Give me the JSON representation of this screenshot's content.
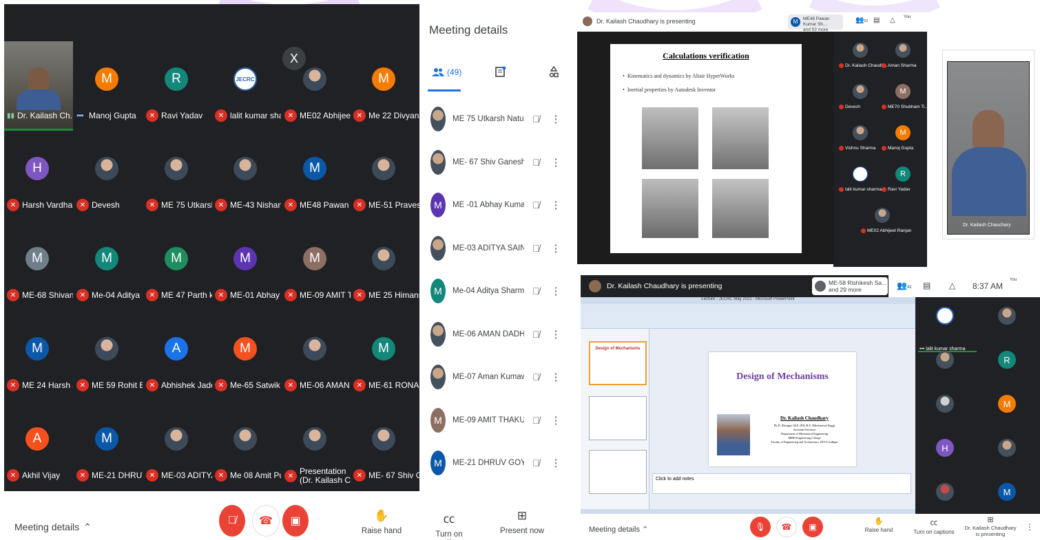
{
  "left": {
    "tiles": [
      {
        "name": "Dr. Kailash Ch...",
        "type": "video"
      },
      {
        "name": "Manoj Gupta",
        "initial": "M",
        "color": "#f57c00",
        "indicator": "dots"
      },
      {
        "name": "Ravi Yadav",
        "initial": "R",
        "color": "#12877a"
      },
      {
        "name": "lalit kumar sha...",
        "initial": "JECRC",
        "type": "logo"
      },
      {
        "name": "ME02 Abhijeet...",
        "type": "photo"
      },
      {
        "name": "Me 22 Divyans...",
        "initial": "M",
        "color": "#f57c00"
      },
      {
        "name": "Harsh Vardhan...",
        "initial": "H",
        "color": "#7e57c2"
      },
      {
        "name": "Devesh",
        "type": "photo"
      },
      {
        "name": "ME 75 Utkarsh...",
        "type": "photo"
      },
      {
        "name": "ME-43 Nishant...",
        "type": "photo"
      },
      {
        "name": "ME48 Pawan ...",
        "initial": "M",
        "color": "#0b57a8"
      },
      {
        "name": "ME-51 Pravesh...",
        "type": "photo"
      },
      {
        "name": "ME-68 Shivans...",
        "initial": "M",
        "color": "#6f7f8a"
      },
      {
        "name": "Me-04 Aditya ...",
        "initial": "M",
        "color": "#12877a"
      },
      {
        "name": "ME 47 Parth k...",
        "initial": "M",
        "color": "#1e8e5e"
      },
      {
        "name": "ME-01 Abhay ...",
        "initial": "M",
        "color": "#5e35b1"
      },
      {
        "name": "ME-09 AMIT T...",
        "initial": "M",
        "color": "#8d6e63"
      },
      {
        "name": "ME 25 Himans...",
        "type": "photo"
      },
      {
        "name": "ME 24 Harsh J...",
        "initial": "M",
        "color": "#0b57a8"
      },
      {
        "name": "ME 59 Rohit B...",
        "type": "photo"
      },
      {
        "name": "Abhishek Jadon",
        "initial": "A",
        "color": "#1a73e8"
      },
      {
        "name": "Me-65 Satwik ...",
        "initial": "M",
        "color": "#f4511e"
      },
      {
        "name": "ME-06 AMAN ...",
        "type": "photo"
      },
      {
        "name": "ME-61 RONAK ...",
        "initial": "M",
        "color": "#12877a"
      },
      {
        "name": "Akhil Vijay",
        "initial": "A",
        "color": "#f4511e"
      },
      {
        "name": "ME-21 DHRUV ...",
        "initial": "M",
        "color": "#0b57a8"
      },
      {
        "name": "ME-03 ADITYA...",
        "type": "photo"
      },
      {
        "name": "Me 08 Amit Pu...",
        "type": "photo"
      },
      {
        "name": "Presentation",
        "name2": "(Dr. Kailash Ch...",
        "type": "photo"
      },
      {
        "name": "ME- 67 Shiv Ga...",
        "type": "photo"
      }
    ],
    "close_label": "X",
    "side": {
      "title": "Meeting details",
      "people_count": "(49)",
      "participants": [
        {
          "name": "ME 75 Utkarsh Natu",
          "type": "photo"
        },
        {
          "name": "ME- 67 Shiv Ganesh Pa...",
          "type": "photo"
        },
        {
          "name": "ME -01 Abhay Kumar Je...",
          "initial": "M",
          "color": "#5e35b1"
        },
        {
          "name": "ME-03 ADITYA SAINI",
          "type": "photo"
        },
        {
          "name": "Me-04 Aditya Sharma",
          "initial": "M",
          "color": "#12877a"
        },
        {
          "name": "ME-06 AMAN DADHICH",
          "type": "photo"
        },
        {
          "name": "ME-07 Aman Kumawat",
          "type": "photo"
        },
        {
          "name": "ME-09 AMIT THAKUR",
          "initial": "M",
          "color": "#8d6e63"
        },
        {
          "name": "ME-21 DHRUV GOYAL",
          "initial": "M",
          "color": "#0b57a8"
        }
      ]
    },
    "bottom": {
      "meeting_details": "Meeting details",
      "raise_hand": "Raise hand",
      "captions": "Turn on captions",
      "present": "Present now"
    }
  },
  "right_top": {
    "presenting": "Dr. Kailash Chaudhary is presenting",
    "chip_name": "ME48 Pawan Kumar Sh...",
    "chip_more": "and 53 more",
    "count": "53",
    "you": "You",
    "slide_title": "Calculations verification",
    "bullets": [
      "Kinematics and dynamics by Altair HyperWorks",
      "Inertial properties by Autodesk Inventor"
    ],
    "strip": [
      {
        "name": "Dr. Kailash Chaudh...",
        "type": "photo"
      },
      {
        "name": "Aman Sharma",
        "type": "photo"
      },
      {
        "name": "Devesh",
        "type": "photo"
      },
      {
        "name": "ME70 Shubham Ti...",
        "initial": "M",
        "color": "#8d6e63"
      },
      {
        "name": "Vishnu Sharma",
        "type": "photo"
      },
      {
        "name": "Manoj Gupta",
        "initial": "M",
        "color": "#f57c00"
      },
      {
        "name": "lalit kumar sharma",
        "type": "logo"
      },
      {
        "name": "Ravi Yadav",
        "initial": "R",
        "color": "#12877a"
      },
      {
        "name": "ME02 Abhijeet Ranjan",
        "type": "photo"
      }
    ],
    "self_name": "Dr. Kailash Chauchary"
  },
  "right_bottom": {
    "presenting": "Dr. Kailash Chaudhary is presenting",
    "chip_name": "ME-58 Rishikesh Sa...",
    "chip_more": "and 29 more",
    "count": "42",
    "time": "8:37 AM",
    "you": "You",
    "ppt_title": "Lecture - JECRC May 2021 - Microsoft PowerPoint",
    "slide_title": "Design of Mechanisms",
    "author": "Dr. Kailash Chaudhary",
    "author_lines": [
      "Ph.D. (Design), M.E. (PI), B.E. (Mechanical Engg)",
      "Assistant Professor",
      "Department of Mechanical Engineering",
      "MBM Engineering College",
      "Faculty of Engineering and Architecture, JNVU Jodhpur"
    ],
    "notes": "Click to add notes",
    "thumb_title": "Design of Mechanisms",
    "strip_top_name": "lalit kumar sharma",
    "meeting_details": "Meeting details",
    "raise_hand": "Raise hand",
    "captions": "Turn on captions",
    "presenter": "Dr. Kailash Chaudhary",
    "presenter2": "is presenting"
  }
}
